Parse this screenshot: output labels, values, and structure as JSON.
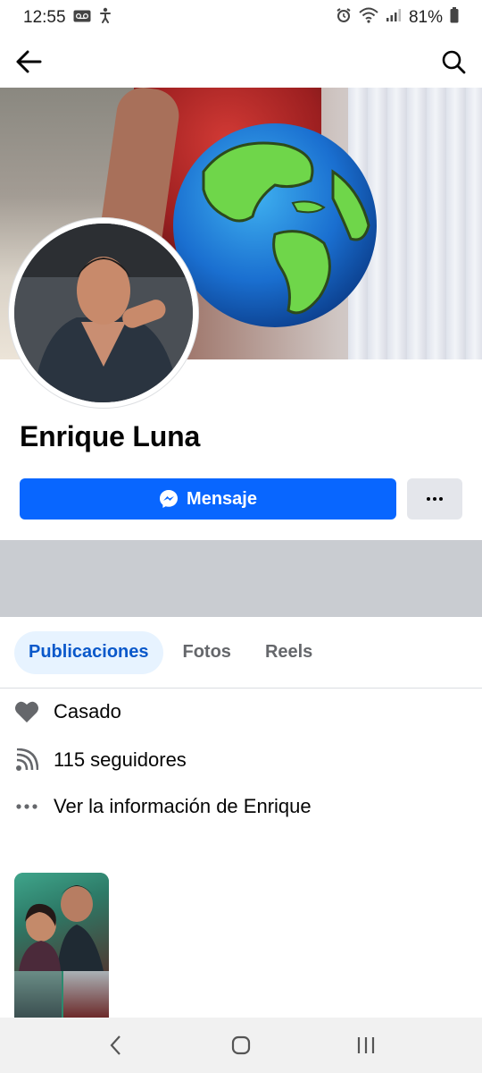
{
  "status_bar": {
    "time": "12:55",
    "battery_percent": "81%"
  },
  "profile": {
    "name": "Enrique Luna"
  },
  "actions": {
    "message_label": "Mensaje",
    "more_icon": "more-dots-icon"
  },
  "tabs": [
    {
      "label": "Publicaciones",
      "active": true
    },
    {
      "label": "Fotos",
      "active": false
    },
    {
      "label": "Reels",
      "active": false
    }
  ],
  "info": {
    "relationship": "Casado",
    "followers": "115 seguidores",
    "see_info": "Ver la información de Enrique"
  },
  "colors": {
    "brand_blue": "#0866ff",
    "tab_active_bg": "#e7f3ff",
    "tab_active_text": "#0a58ca"
  }
}
